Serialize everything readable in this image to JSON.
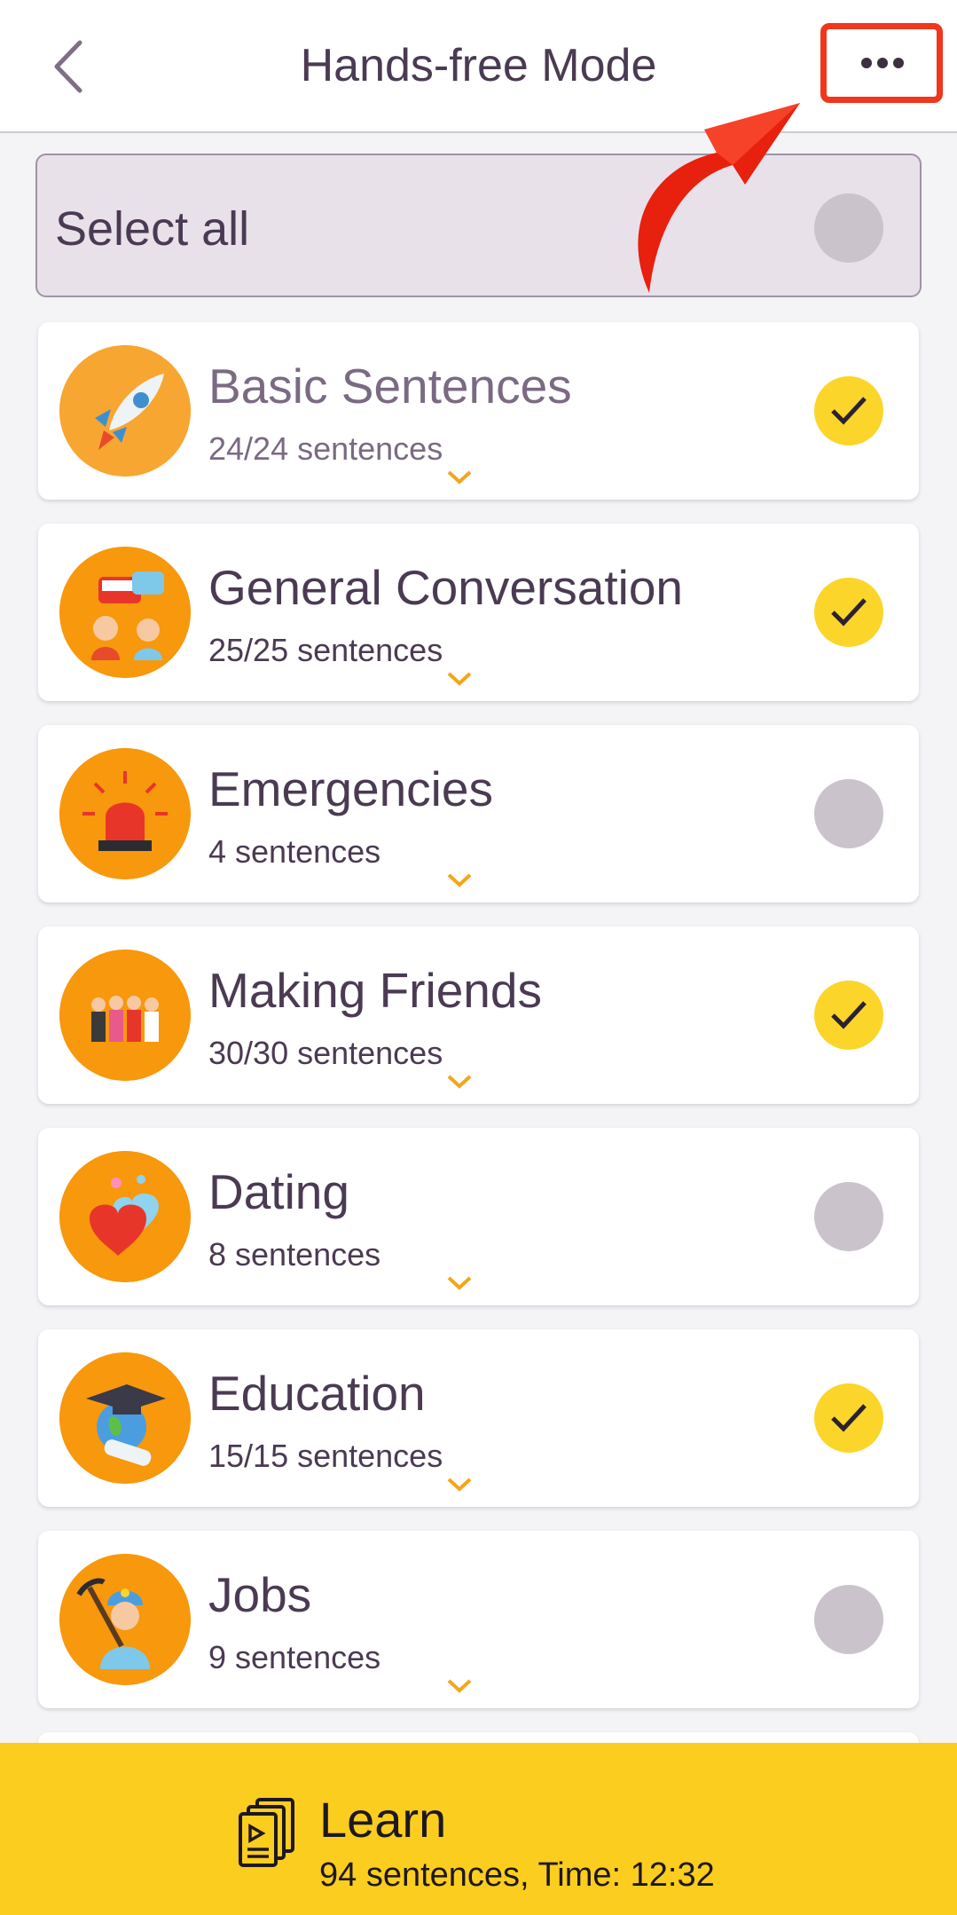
{
  "header": {
    "title": "Hands-free Mode",
    "back_icon": "chevron-left-icon",
    "more_icon": "more-horizontal-icon"
  },
  "select_all": {
    "label": "Select all",
    "checked": false
  },
  "categories": [
    {
      "name": "Basic Sentences",
      "count": "24/24 sentences",
      "checked": true,
      "icon": "rocket-icon"
    },
    {
      "name": "General Conversation",
      "count": "25/25 sentences",
      "checked": true,
      "icon": "conversation-icon"
    },
    {
      "name": "Emergencies",
      "count": "4 sentences",
      "checked": false,
      "icon": "siren-icon"
    },
    {
      "name": "Making Friends",
      "count": "30/30 sentences",
      "checked": true,
      "icon": "friends-icon"
    },
    {
      "name": "Dating",
      "count": "8 sentences",
      "checked": false,
      "icon": "hearts-icon"
    },
    {
      "name": "Education",
      "count": "15/15 sentences",
      "checked": true,
      "icon": "graduation-globe-icon"
    },
    {
      "name": "Jobs",
      "count": "9 sentences",
      "checked": false,
      "icon": "miner-icon"
    }
  ],
  "learn": {
    "title": "Learn",
    "subtitle": "94 sentences, Time: 12:32",
    "icon": "document-stack-icon"
  },
  "colors": {
    "accent": "#fbd52a",
    "icon_bg": "#f7980d",
    "highlight": "#f0361c",
    "unchecked": "#cbc3cc"
  }
}
